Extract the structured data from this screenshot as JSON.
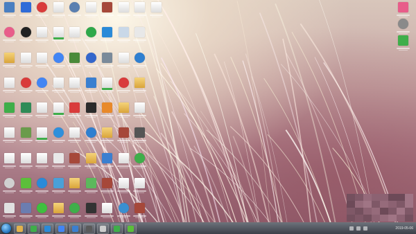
{
  "desktop": {
    "icons": [
      {
        "name": "computer-icon",
        "color": "#4a7fc1",
        "shape": "square"
      },
      {
        "name": "app-icon-colorful",
        "color": "#e85d8a",
        "shape": "round"
      },
      {
        "name": "folder-icon",
        "color": "#e2b24c",
        "shape": "folder"
      },
      {
        "name": "document-icon",
        "color": "#ffffff",
        "shape": "doc"
      },
      {
        "name": "app-icon-green",
        "color": "#3fae4a",
        "shape": "square"
      },
      {
        "name": "document-icon",
        "color": "#ffffff",
        "shape": "doc"
      },
      {
        "name": "document-icon",
        "color": "#ffffff",
        "shape": "doc"
      },
      {
        "name": "settings-icon",
        "color": "#d0d0d0",
        "shape": "round"
      },
      {
        "name": "keyboard-icon",
        "color": "#e0e0e0",
        "shape": "square"
      },
      {
        "name": "monitor-icon",
        "color": "#2f6bd8",
        "shape": "square"
      },
      {
        "name": "qq-icon",
        "color": "#222222",
        "shape": "round"
      },
      {
        "name": "document-icon",
        "color": "#ffffff",
        "shape": "doc"
      },
      {
        "name": "netease-music-icon",
        "color": "#d93b3b",
        "shape": "round"
      },
      {
        "name": "image-icon",
        "color": "#2e8b57",
        "shape": "square"
      },
      {
        "name": "photo-icon",
        "color": "#6a9b4c",
        "shape": "square"
      },
      {
        "name": "document-icon",
        "color": "#ffffff",
        "shape": "doc"
      },
      {
        "name": "app-icon-green",
        "color": "#5cbf3a",
        "shape": "square"
      },
      {
        "name": "tools-icon",
        "color": "#6b7db0",
        "shape": "square"
      },
      {
        "name": "netease-music-icon",
        "color": "#d93b3b",
        "shape": "round"
      },
      {
        "name": "document-icon",
        "color": "#ffffff",
        "shape": "doc"
      },
      {
        "name": "document-icon",
        "color": "#ffffff",
        "shape": "doc"
      },
      {
        "name": "chrome-icon",
        "color": "#4285f4",
        "shape": "round"
      },
      {
        "name": "document-icon",
        "color": "#ffffff",
        "shape": "doc"
      },
      {
        "name": "spreadsheet-icon",
        "color": "#3fae4a",
        "shape": "doc"
      },
      {
        "name": "document-icon",
        "color": "#ffffff",
        "shape": "doc"
      },
      {
        "name": "internet-explorer-icon",
        "color": "#2a8ad8",
        "shape": "round"
      },
      {
        "name": "wechat-icon",
        "color": "#3fbf3f",
        "shape": "round"
      },
      {
        "name": "document-icon",
        "color": "#ffffff",
        "shape": "doc"
      },
      {
        "name": "spreadsheet-icon",
        "color": "#3fae4a",
        "shape": "doc"
      },
      {
        "name": "chrome-icon",
        "color": "#4285f4",
        "shape": "round"
      },
      {
        "name": "document-icon",
        "color": "#ffffff",
        "shape": "doc"
      },
      {
        "name": "spreadsheet-icon",
        "color": "#3fae4a",
        "shape": "doc"
      },
      {
        "name": "browser-icon",
        "color": "#2f8fdb",
        "shape": "round"
      },
      {
        "name": "calculator-icon",
        "color": "#e8e8e8",
        "shape": "square"
      },
      {
        "name": "network-icon",
        "color": "#4aa0d8",
        "shape": "square"
      },
      {
        "name": "folder-icon",
        "color": "#e2b24c",
        "shape": "folder"
      },
      {
        "name": "user-icon",
        "color": "#5a7fb0",
        "shape": "round"
      },
      {
        "name": "document-icon",
        "color": "#ffffff",
        "shape": "doc"
      },
      {
        "name": "minecraft-icon",
        "color": "#4a8a3a",
        "shape": "square"
      },
      {
        "name": "document-icon",
        "color": "#ffffff",
        "shape": "doc"
      },
      {
        "name": "pdf-icon",
        "color": "#d93b3b",
        "shape": "square"
      },
      {
        "name": "document-icon",
        "color": "#ffffff",
        "shape": "doc"
      },
      {
        "name": "winrar-icon",
        "color": "#a6483a",
        "shape": "square"
      },
      {
        "name": "folder-icon",
        "color": "#e2b24c",
        "shape": "folder"
      },
      {
        "name": "app-icon-green",
        "color": "#3fae4a",
        "shape": "round"
      },
      {
        "name": "document-icon",
        "color": "#ffffff",
        "shape": "doc"
      },
      {
        "name": "browser-icon",
        "color": "#2fa84a",
        "shape": "round"
      },
      {
        "name": "swf-icon",
        "color": "#3366cc",
        "shape": "round"
      },
      {
        "name": "arrow-icon",
        "color": "#3a7fd0",
        "shape": "square"
      },
      {
        "name": "terminal-icon",
        "color": "#2b2b2b",
        "shape": "square"
      },
      {
        "name": "app-icon-blue",
        "color": "#2f7fd0",
        "shape": "round"
      },
      {
        "name": "folder-icon",
        "color": "#e2b24c",
        "shape": "folder"
      },
      {
        "name": "chat-icon",
        "color": "#5cb85c",
        "shape": "square"
      },
      {
        "name": "game-icon",
        "color": "#333333",
        "shape": "square"
      },
      {
        "name": "winrar-icon",
        "color": "#a6483a",
        "shape": "square"
      },
      {
        "name": "windows-icon",
        "color": "#2a8ad8",
        "shape": "square"
      },
      {
        "name": "music-icon",
        "color": "#7a8a9a",
        "shape": "square"
      },
      {
        "name": "spreadsheet-icon",
        "color": "#3fae4a",
        "shape": "doc"
      },
      {
        "name": "app-icon-orange",
        "color": "#e8892a",
        "shape": "square"
      },
      {
        "name": "folder-icon",
        "color": "#e2b24c",
        "shape": "folder"
      },
      {
        "name": "app-icon-blue",
        "color": "#3b7fd0",
        "shape": "square"
      },
      {
        "name": "winrar-icon",
        "color": "#a6483a",
        "shape": "square"
      },
      {
        "name": "document-icon",
        "color": "#ffffff",
        "shape": "doc"
      },
      {
        "name": "document-icon",
        "color": "#ffffff",
        "shape": "doc"
      },
      {
        "name": "picture-icon",
        "color": "#c9d8e8",
        "shape": "square"
      },
      {
        "name": "document-icon",
        "color": "#ffffff",
        "shape": "doc"
      },
      {
        "name": "netease-music-icon",
        "color": "#d93b3b",
        "shape": "round"
      },
      {
        "name": "folder-icon",
        "color": "#e2b24c",
        "shape": "folder"
      },
      {
        "name": "winrar-icon",
        "color": "#a6483a",
        "shape": "square"
      },
      {
        "name": "document-icon",
        "color": "#ffffff",
        "shape": "doc"
      },
      {
        "name": "document-icon",
        "color": "#ffffff",
        "shape": "doc"
      },
      {
        "name": "photo-viewer-icon",
        "color": "#3a8fd0",
        "shape": "round"
      },
      {
        "name": "document-icon",
        "color": "#ffffff",
        "shape": "doc"
      },
      {
        "name": "calculator-icon",
        "color": "#e8e8e8",
        "shape": "square"
      },
      {
        "name": "app-icon-blue",
        "color": "#2f7fd0",
        "shape": "round"
      },
      {
        "name": "folder-icon",
        "color": "#e2b24c",
        "shape": "folder"
      },
      {
        "name": "document-icon",
        "color": "#ffffff",
        "shape": "doc"
      },
      {
        "name": "media-icon",
        "color": "#555555",
        "shape": "square"
      },
      {
        "name": "browser-icon",
        "color": "#3fae4a",
        "shape": "round"
      },
      {
        "name": "document-icon",
        "color": "#ffffff",
        "shape": "doc"
      },
      {
        "name": "winrar-icon",
        "color": "#a6483a",
        "shape": "square"
      },
      {
        "name": "document-icon",
        "color": "#ffffff",
        "shape": "doc"
      }
    ],
    "right_icons": [
      {
        "name": "app-icon-colorful",
        "color": "#e85d8a",
        "shape": "square"
      },
      {
        "name": "settings-icon",
        "color": "#8a8a8a",
        "shape": "round"
      },
      {
        "name": "app-icon-green",
        "color": "#3fae4a",
        "shape": "square"
      }
    ]
  },
  "taskbar": {
    "buttons": [
      {
        "name": "explorer-button",
        "color": "#e2b24c"
      },
      {
        "name": "browser-button",
        "color": "#3fae4a"
      },
      {
        "name": "media-player-button",
        "color": "#2a8ad8"
      },
      {
        "name": "chrome-button",
        "color": "#4285f4"
      },
      {
        "name": "app-button",
        "color": "#3b7fd0"
      },
      {
        "name": "screen-button",
        "color": "#5a5a5a"
      },
      {
        "name": "recycle-button",
        "color": "#cccccc"
      },
      {
        "name": "app-button",
        "color": "#3fae4a"
      },
      {
        "name": "app-button",
        "color": "#5cbf3a"
      }
    ],
    "clock_text": "2019-05-06"
  }
}
